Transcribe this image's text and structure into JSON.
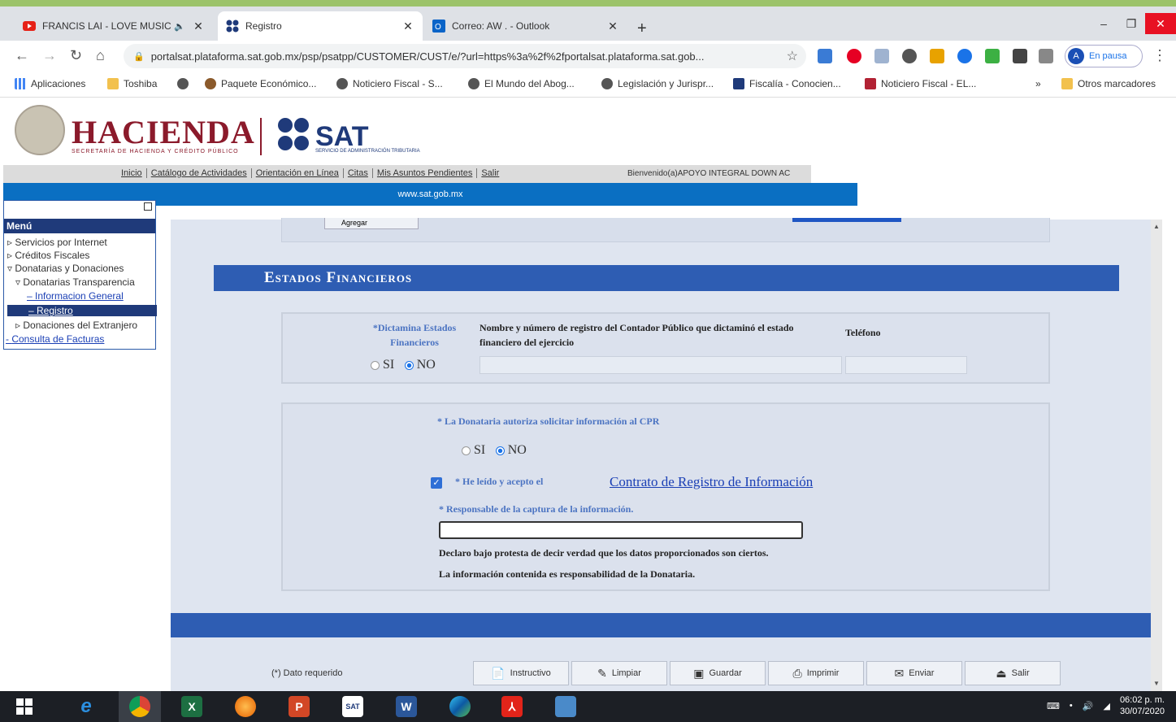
{
  "browser": {
    "tabs": [
      {
        "label": "FRANCIS LAI - LOVE MUSIC",
        "icon": "youtube-icon",
        "active": false
      },
      {
        "label": "Registro",
        "icon": "sat-favicon",
        "active": true
      },
      {
        "label": "Correo: AW . - Outlook",
        "icon": "outlook-icon",
        "active": false
      }
    ],
    "url": "portalsat.plataforma.sat.gob.mx/psp/psatpp/CUSTOMER/CUST/e/?url=https%3a%2f%2fportalsat.plataforma.sat.gob...",
    "profile_label": "En pausa",
    "profile_initial": "A",
    "bookmarks": [
      "Aplicaciones",
      "Toshiba",
      "",
      "Paquete Económico...",
      "Noticiero Fiscal - S...",
      "El Mundo del Abog...",
      "Legislación y Jurispr...",
      "Fiscalía - Conocien...",
      "Noticiero Fiscal - EL...",
      "Otros marcadores"
    ]
  },
  "header": {
    "hacienda": "HACIENDA",
    "hacienda_sub": "SECRETARÍA DE HACIENDA Y CRÉDITO PÚBLICO",
    "sat": "SAT",
    "sat_sub": "SERVICIO DE ADMINISTRACIÓN TRIBUTARIA",
    "nav": [
      "Inicio",
      "Catálogo de Actividades",
      "Orientación en Línea",
      "Citas",
      "Mis Asuntos Pendientes",
      "Salir"
    ],
    "welcome": "Bienvenido(a)APOYO INTEGRAL DOWN AC",
    "site": "www.sat.gob.mx"
  },
  "menu": {
    "title": "Menú",
    "items": [
      "Servicios por Internet",
      "Créditos Fiscales",
      "Donatarias y Donaciones",
      "Donatarias Transparencia",
      "Informacion General",
      "Registro",
      "Donaciones del Extranjero",
      "Consulta de Facturas"
    ]
  },
  "top_button": "Agregar",
  "section_title": "Estados Financieros",
  "dictamen": {
    "label": "*Dictamina Estados Financieros",
    "contador_label": "Nombre y número de registro del Contador Público que dictaminó el estado financiero del ejercicio",
    "telefono_label": "Teléfono",
    "si": "SI",
    "no": "NO",
    "selected": "NO",
    "contador_value": "",
    "telefono_value": ""
  },
  "autoriza": {
    "label": "* La Donataria autoriza solicitar información al CPR",
    "si": "SI",
    "no": "NO",
    "selected": "NO",
    "acepto_label": "* He leído y acepto el",
    "acepto_checked": true,
    "contrato_link": "Contrato de Registro de Información",
    "responsable_label": "* Responsable de la captura de la información.",
    "responsable_value": "",
    "declaro": "Declaro bajo protesta de decir verdad que los datos proporcionados son ciertos.",
    "responsabilidad": "La información contenida es responsabilidad de la Donataria."
  },
  "footer": {
    "required": "(*) Dato requerido",
    "buttons": [
      "Instructivo",
      "Limpiar",
      "Guardar",
      "Imprimir",
      "Enviar",
      "Salir"
    ]
  },
  "taskbar": {
    "time": "06:02 p. m.",
    "date": "30/07/2020"
  }
}
